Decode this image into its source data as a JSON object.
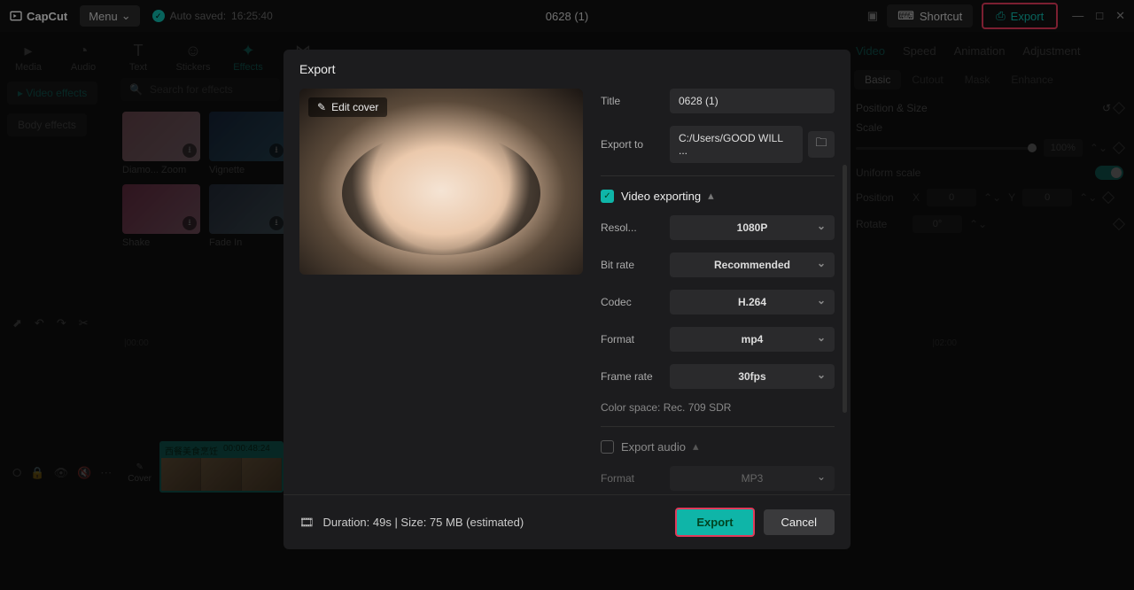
{
  "app": {
    "name": "CapCut",
    "menu": "Menu",
    "autosave_prefix": "Auto saved:",
    "autosave_time": "16:25:40",
    "project_title": "0628 (1)"
  },
  "topbar": {
    "shortcut": "Shortcut",
    "export": "Export"
  },
  "media_tabs": [
    "Media",
    "Audio",
    "Text",
    "Stickers",
    "Effects",
    "Trans..."
  ],
  "effects_panel": {
    "types": {
      "video": "Video effects",
      "body": "Body effects"
    },
    "search_placeholder": "Search for effects",
    "items": [
      "Diamo... Zoom",
      "Vignette",
      "Shake",
      "Fade In"
    ]
  },
  "right_panel": {
    "tabs": [
      "Video",
      "Speed",
      "Animation",
      "Adjustment"
    ],
    "subtabs": [
      "Basic",
      "Cutout",
      "Mask",
      "Enhance"
    ],
    "position_size": "Position & Size",
    "scale": "Scale",
    "scale_value": "100%",
    "uniform": "Uniform scale",
    "position": "Position",
    "pos_x_label": "X",
    "pos_x": "0",
    "pos_y_label": "Y",
    "pos_y": "0",
    "rotate": "Rotate",
    "rotate_value": "0°"
  },
  "timeline": {
    "marks": [
      "00:00",
      "02:00"
    ],
    "clip_name": "西餐美食烹饪",
    "clip_time": "00:00:48:24",
    "cover_label": "Cover"
  },
  "modal": {
    "title": "Export",
    "edit_cover": "Edit cover",
    "fields": {
      "title_label": "Title",
      "title_value": "0628 (1)",
      "exportto_label": "Export to",
      "exportto_value": "C:/Users/GOOD WILL ...",
      "video_exporting": "Video exporting",
      "resolution_label": "Resol...",
      "resolution_value": "1080P",
      "bitrate_label": "Bit rate",
      "bitrate_value": "Recommended",
      "codec_label": "Codec",
      "codec_value": "H.264",
      "format_label": "Format",
      "format_value": "mp4",
      "framerate_label": "Frame rate",
      "framerate_value": "30fps",
      "colorspace": "Color space: Rec. 709 SDR",
      "export_audio": "Export audio",
      "audio_format_label": "Format",
      "audio_format_value": "MP3"
    },
    "footer": {
      "duration": "Duration: 49s | Size: 75 MB (estimated)",
      "export": "Export",
      "cancel": "Cancel"
    }
  }
}
